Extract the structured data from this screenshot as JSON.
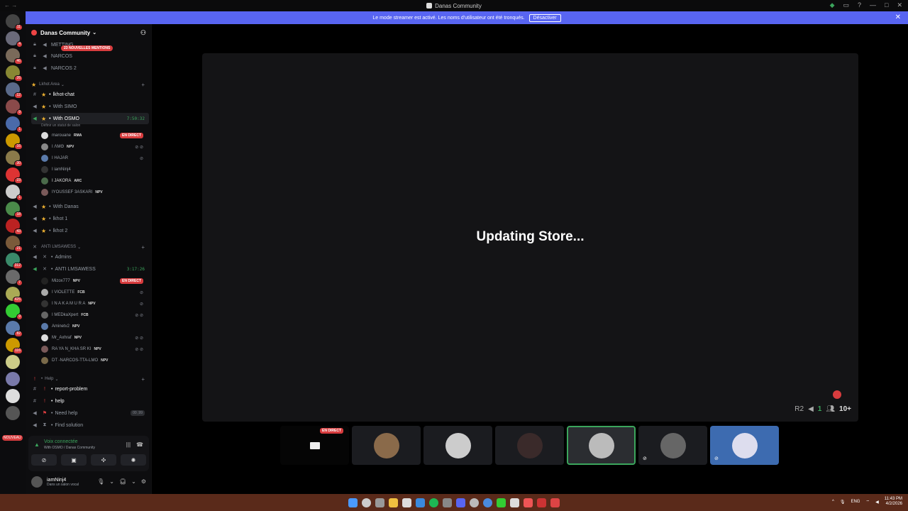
{
  "window": {
    "title": "Danas Community"
  },
  "banner": {
    "text": "Le mode streamer est activé. Les noms d'utilisateur ont été tronqués.",
    "button": "Désactiver"
  },
  "servers": {
    "badges": [
      "11",
      "4",
      "46",
      "26",
      "12",
      "9",
      "1",
      "16",
      "30",
      "23",
      "1",
      "18",
      "43",
      "21",
      "312",
      "7",
      "425",
      "9",
      "82",
      "116"
    ],
    "nouveau": "NOUVEAU"
  },
  "sidebar": {
    "guild_name": "Danas Community",
    "mentions": "23 NOUVELLES MENTIONS",
    "channels_top": [
      "METTING",
      "NARCOS",
      "NARCOS 2"
    ],
    "cat_lkhot": "Lkhot Area",
    "lkhot_chat": "lkhot-chat",
    "with_simo": "With SIMO",
    "with_osmo": "With OSMO",
    "with_osmo_time": "7:50:32",
    "status_prompt": "Définir un statut de salon",
    "osmo_members": [
      {
        "name": "marouane",
        "tag": "RMA",
        "live": "EN DIRECT"
      },
      {
        "name": "I ΛΜΘ",
        "tag": "NPV"
      },
      {
        "name": "I HAJAR",
        "tag": ""
      },
      {
        "name": "I iamNinj4",
        "tag": ""
      },
      {
        "name": "I JAKORA",
        "tag": "ARC"
      },
      {
        "name": "IYOUSSEF 3ASKARI",
        "tag": "NPV"
      }
    ],
    "with_danas": "With Danas",
    "lkhot1": "lkhot 1",
    "lkhot2": "lkhot 2",
    "cat_anti": "ANTI LMSAWESS",
    "admins": "Admins",
    "anti_channel": "ANTI LMSAWESS",
    "anti_time": "3:17:26",
    "anti_members": [
      {
        "name": "Mizox777",
        "tag": "NPV"
      },
      {
        "name": "I VIOLETTE",
        "tag": "FCB"
      },
      {
        "name": "I N A K A M U R A",
        "tag": "NPV"
      },
      {
        "name": "I MEDkaXpert",
        "tag": "FCB"
      },
      {
        "name": "Aminetv2",
        "tag": "NPV"
      },
      {
        "name": "Mr_Axhraf",
        "tag": "NPV"
      },
      {
        "name": "RA YA N_KHA SR KI",
        "tag": "NPV"
      },
      {
        "name": "DT -NARCOS-TTA-LMO",
        "tag": "NPV"
      }
    ],
    "anti_live": "EN DIRECT",
    "cat_help": "Help",
    "report": "report-problem",
    "help": "help",
    "need_help": "Need help",
    "need_help_badge": "00 ,99",
    "find_solution": "Find solution"
  },
  "voice": {
    "status": "Voix connectée",
    "location": "With OSMO / Danas Community"
  },
  "user": {
    "name": "iamNinj4",
    "sub": "Dans un salon vocal"
  },
  "stage": {
    "message": "Updating Store...",
    "stat_r2": "R2",
    "stat_one": "1",
    "viewers": "10+",
    "tile_live": "EN DIRECT"
  },
  "taskbar": {
    "lang": "ENG",
    "time": "11:43 PM",
    "date": "4/2/2026"
  }
}
